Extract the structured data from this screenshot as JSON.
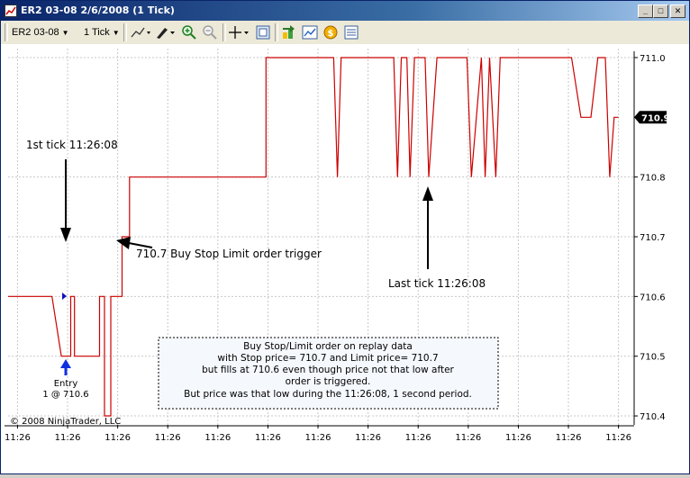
{
  "window": {
    "title": "ER2 03-08  2/6/2008 (1 Tick)",
    "buttons": {
      "minimize": "_",
      "maximize": "□",
      "close": "✕"
    }
  },
  "toolbar": {
    "instrument": "ER2 03-08",
    "interval": "1 Tick"
  },
  "chart_data": {
    "type": "line",
    "series": [
      {
        "color": "#cc0000",
        "x": [
          0,
          7,
          7,
          8.5,
          8.5,
          10,
          10,
          10.6,
          10.6,
          12.5,
          12.5,
          14.6,
          14.6,
          15.4,
          15.4,
          16.4,
          16.4,
          17.4,
          17.4,
          18.2,
          18.2,
          19.4,
          19.4,
          41.2,
          41.2,
          52,
          52,
          52.6,
          52.6,
          53.2,
          53.2,
          61.6,
          61.6,
          62.2,
          62.2,
          62.8,
          62.8,
          63.7,
          63.7,
          64.2,
          64.2,
          64.9,
          64.9,
          66.6,
          66.6,
          67.2,
          67.2,
          68.5,
          68.5,
          73.3,
          73.3,
          74,
          74,
          75.6,
          75.6,
          76.2,
          76.2,
          76.9,
          76.9,
          77.9,
          77.9,
          78.6,
          78.6,
          79.6,
          79.6,
          90,
          90,
          91.5,
          91.5,
          93.1,
          93.1,
          94.2,
          94.2,
          94.9,
          94.9,
          95.4,
          95.4,
          96.1,
          96.1,
          96.8,
          96.8,
          97.5
        ],
        "y": [
          710.6,
          710.6,
          710.6,
          710.5,
          710.5,
          710.5,
          710.6,
          710.6,
          710.5,
          710.5,
          710.5,
          710.5,
          710.6,
          710.6,
          710.4,
          710.4,
          710.6,
          710.6,
          710.6,
          710.6,
          710.7,
          710.7,
          710.8,
          710.8,
          711.0,
          711.0,
          711.0,
          710.8,
          710.8,
          711.0,
          711.0,
          711.0,
          711.0,
          710.8,
          710.8,
          711.0,
          711.0,
          711.0,
          711.0,
          710.8,
          710.8,
          711.0,
          711.0,
          711.0,
          711.0,
          710.8,
          710.8,
          711.0,
          711.0,
          711.0,
          711.0,
          710.8,
          710.8,
          711.0,
          711.0,
          710.8,
          710.8,
          711.0,
          711.0,
          710.8,
          710.8,
          711.0,
          711.0,
          711.0,
          711.0,
          711.0,
          711.0,
          710.9,
          710.9,
          710.9,
          710.9,
          711.0,
          711.0,
          711.0,
          711.0,
          711.0,
          711.0,
          710.8,
          710.8,
          710.9,
          710.9,
          710.9
        ]
      }
    ],
    "xlim": [
      0,
      100
    ],
    "ylim": [
      710.385,
      711.015
    ],
    "y_ticks": [
      {
        "value": 711.0,
        "label": "711.0"
      },
      {
        "value": 710.8,
        "label": "710.8"
      },
      {
        "value": 710.7,
        "label": "710.7"
      },
      {
        "value": 710.6,
        "label": "710.6"
      },
      {
        "value": 710.5,
        "label": "710.5"
      },
      {
        "value": 710.4,
        "label": "710.4"
      }
    ],
    "x_ticks": [
      {
        "value": 1.5,
        "label": "11:26"
      },
      {
        "value": 9.5,
        "label": "11:26"
      },
      {
        "value": 17.5,
        "label": "11:26"
      },
      {
        "value": 25.5,
        "label": "11:26"
      },
      {
        "value": 33.5,
        "label": "11:26"
      },
      {
        "value": 41.5,
        "label": "11:26"
      },
      {
        "value": 49.5,
        "label": "11:26"
      },
      {
        "value": 57.5,
        "label": "11:26"
      },
      {
        "value": 65.5,
        "label": "11:26"
      },
      {
        "value": 73.5,
        "label": "11:26"
      },
      {
        "value": 81.5,
        "label": "11:26"
      },
      {
        "value": 89.5,
        "label": "11:26"
      },
      {
        "value": 97.5,
        "label": "11:26"
      }
    ],
    "last_price": {
      "value": 710.9,
      "label": "710.9"
    },
    "grid": true,
    "annotations": {
      "first_tick": "1st tick 11:26:08",
      "trigger": "710.7 Buy Stop Limit order trigger",
      "last_tick": "Last tick 11:26:08",
      "entry_label": "Entry",
      "entry_fill": "1 @ 710.6",
      "note_lines": [
        "Buy Stop/Limit order on replay data",
        "with Stop price= 710.7 and Limit price= 710.7",
        "but fills at 710.6 even though price not that low after",
        "order is triggered.",
        "But price was that low during the 11:26:08, 1 second period."
      ],
      "copyright": "© 2008 NinjaTrader, LLC"
    }
  }
}
